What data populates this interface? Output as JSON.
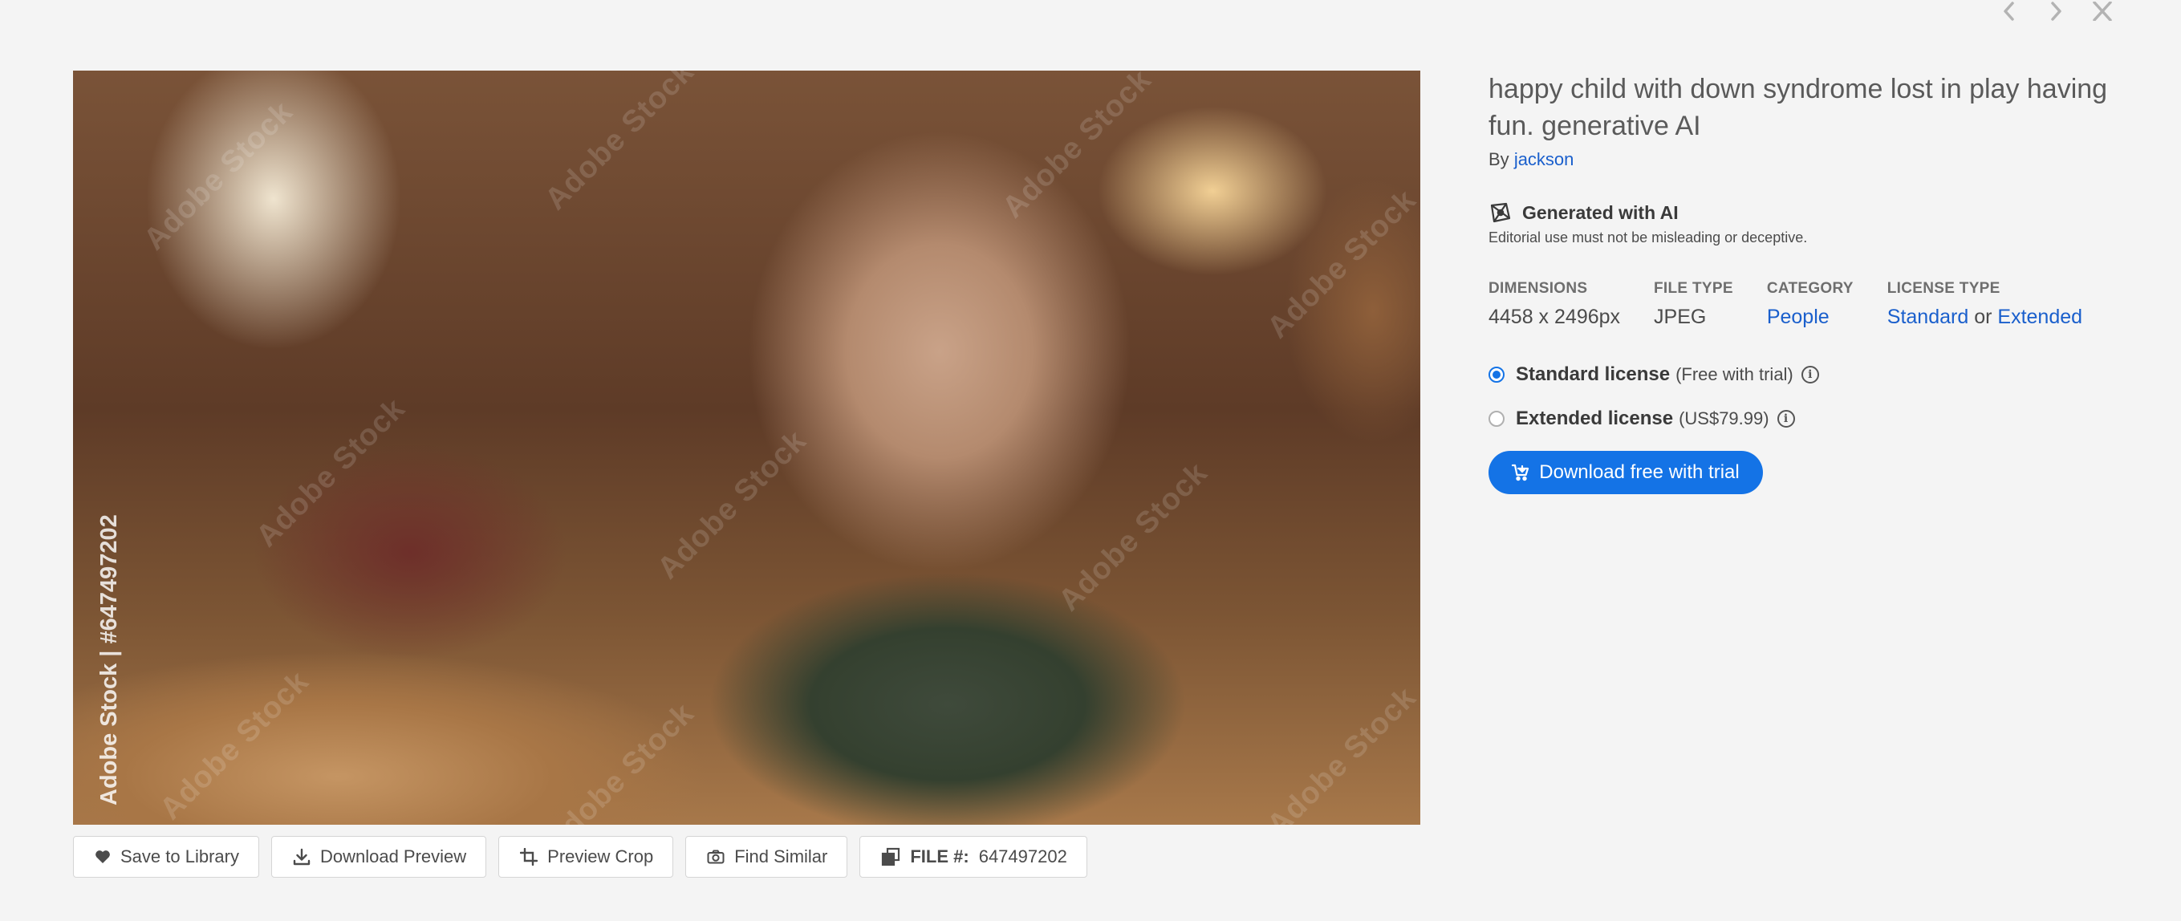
{
  "nav": {
    "prev_icon": "chevron-left-icon",
    "next_icon": "chevron-right-icon",
    "close_icon": "close-icon"
  },
  "image": {
    "alt": "happy child with down syndrome lost in play having fun. generative AI",
    "watermark": "Adobe Stock",
    "side_mark": "Adobe Stock | #647497202"
  },
  "actions": {
    "save": "Save to Library",
    "download_preview": "Download Preview",
    "preview_crop": "Preview Crop",
    "find_similar": "Find Similar",
    "file_label": "FILE #:",
    "file_number": "647497202"
  },
  "asset": {
    "title": "happy child with down syndrome lost in play having fun. generative AI",
    "by_prefix": "By",
    "author": "jackson",
    "ai_label": "Generated with AI",
    "ai_note": "Editorial use must not be misleading or deceptive."
  },
  "meta": {
    "dimensions_head": "DIMENSIONS",
    "dimensions": "4458 x 2496px",
    "filetype_head": "FILE TYPE",
    "filetype": "JPEG",
    "category_head": "CATEGORY",
    "category": "People",
    "license_head": "LICENSE TYPE",
    "license_standard": "Standard",
    "license_or": "or",
    "license_extended": "Extended"
  },
  "licenses": {
    "standard_name": "Standard license",
    "standard_price": "(Free with trial)",
    "extended_name": "Extended license",
    "extended_price": "(US$79.99)",
    "selected": "standard"
  },
  "cta": {
    "label": "Download free with trial"
  },
  "colors": {
    "accent": "#1473e6",
    "link": "#1a5fcc",
    "background": "#f4f4f4"
  }
}
